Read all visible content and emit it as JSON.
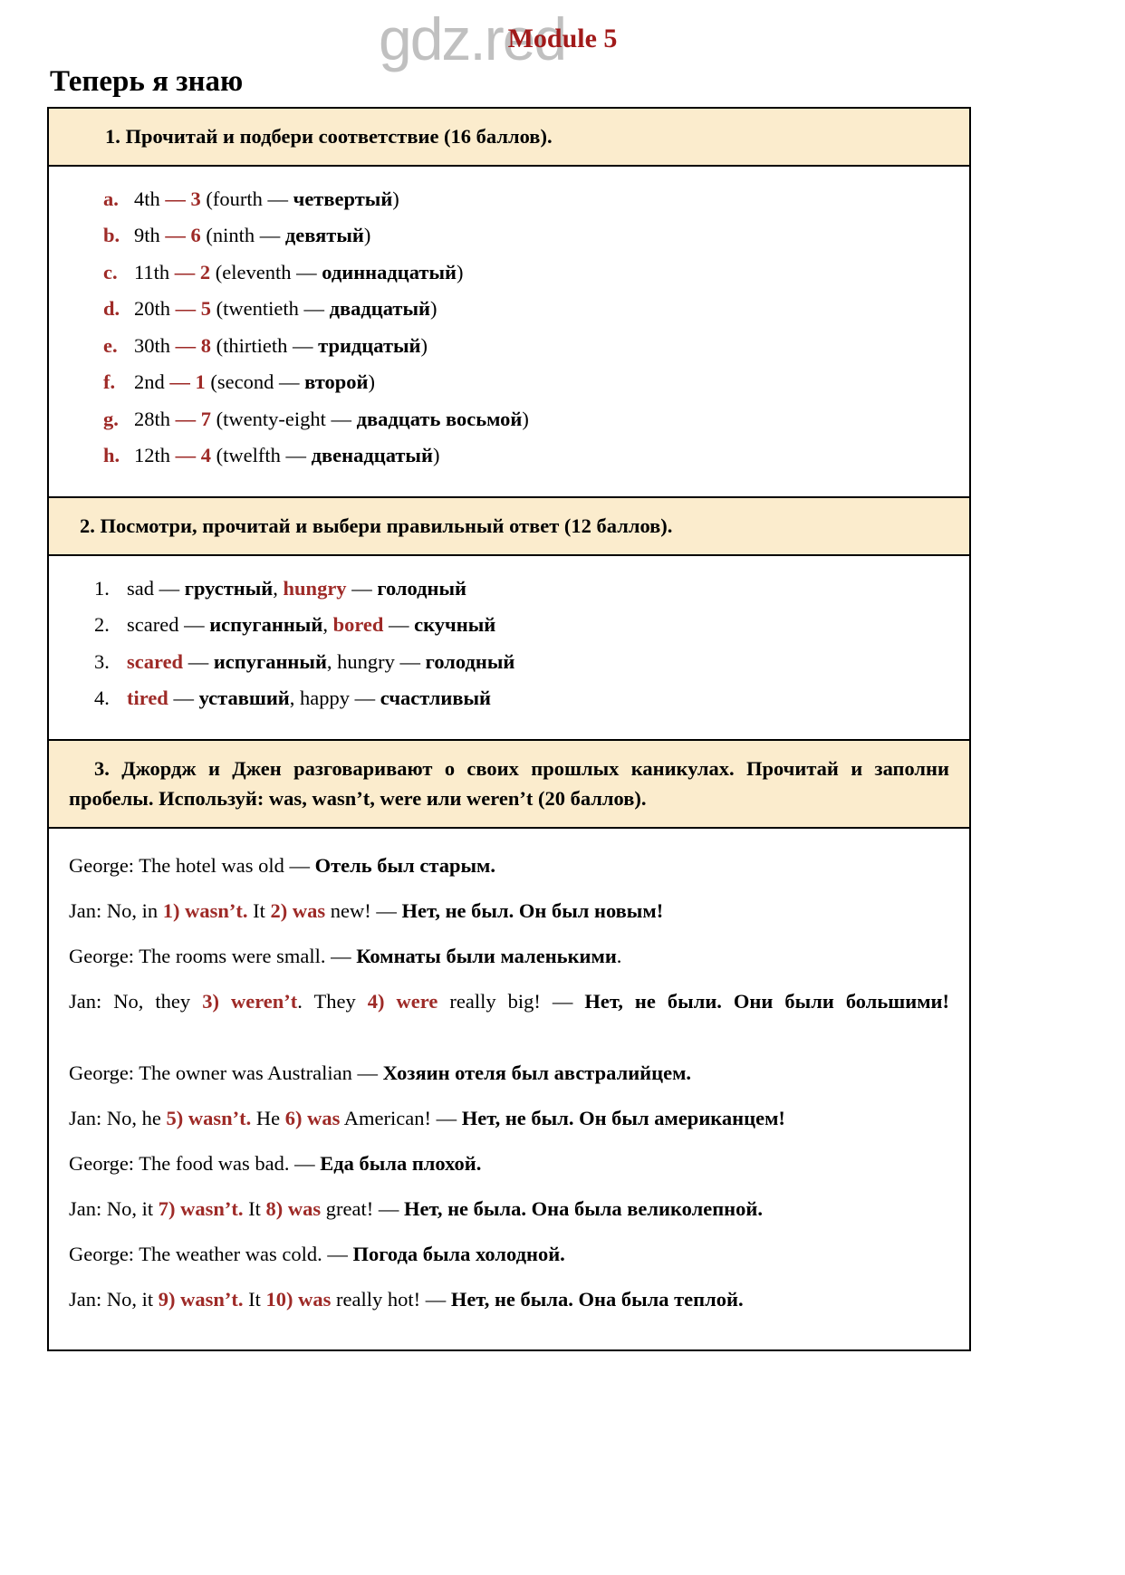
{
  "page": {
    "module_title": "Module 5",
    "section_title": "Теперь я знаю",
    "watermark": "gdz.red",
    "accent_red": "#9e2a27",
    "title_red": "#a11a1a",
    "band_bg": "#fbeccd"
  },
  "task1": {
    "header": "1.  Прочитай и подбери соответствие (16 баллов).",
    "items": [
      {
        "marker": "a.",
        "ordinal": "4th",
        "dash": "—",
        "answer": "3",
        "open": "(fourth",
        "mid": "—",
        "ru": "четвертый",
        "close": ")"
      },
      {
        "marker": "b.",
        "ordinal": "9th",
        "dash": "—",
        "answer": "6",
        "open": "(ninth",
        "mid": "—",
        "ru": "девятый",
        "close": ")"
      },
      {
        "marker": "c.",
        "ordinal": "11th",
        "dash": "—",
        "answer": "2",
        "open": "(eleventh",
        "mid": "—",
        "ru": "одиннадцатый",
        "close": ")"
      },
      {
        "marker": "d.",
        "ordinal": "20th",
        "dash": "—",
        "answer": "5",
        "open": "(twentieth",
        "mid": "—",
        "ru": "двадцатый",
        "close": ")"
      },
      {
        "marker": "e.",
        "ordinal": "30th",
        "dash": "—",
        "answer": "8",
        "open": "(thirtieth",
        "mid": "—",
        "ru": "тридцатый",
        "close": ")"
      },
      {
        "marker": "f.",
        "ordinal": "2nd",
        "dash": "—",
        "answer": "1",
        "open": "(second",
        "mid": "—",
        "ru": "второй",
        "close": ")"
      },
      {
        "marker": "g.",
        "ordinal": "28th",
        "dash": "—",
        "answer": "7",
        "open": "(twenty-eight",
        "mid": "—",
        "ru": "двадцать восьмой",
        "close": ")"
      },
      {
        "marker": "h.",
        "ordinal": "12th",
        "dash": "—",
        "answer": "4",
        "open": "(twelfth",
        "mid": "—",
        "ru": "двенадцатый",
        "close": ")"
      }
    ]
  },
  "task2": {
    "header": "2. Посмотри, прочитай и выбери правильный ответ (12 баллов).",
    "items": [
      {
        "marker": "1.",
        "w1_en": "sad",
        "w1_en_selected": false,
        "w1_dash": "—",
        "w1_ru": "грустный",
        "comma": ",",
        "w2_en": "hungry",
        "w2_en_selected": true,
        "w2_dash": "—",
        "w2_ru": "голодный"
      },
      {
        "marker": "2.",
        "w1_en": "scared",
        "w1_en_selected": false,
        "w1_dash": "—",
        "w1_ru": "испуганный",
        "comma": ",",
        "w2_en": "bored",
        "w2_en_selected": true,
        "w2_dash": "—",
        "w2_ru": "скучный"
      },
      {
        "marker": "3.",
        "w1_en": "scared",
        "w1_en_selected": true,
        "w1_dash": "—",
        "w1_ru": "испуганный",
        "comma": ",",
        "w2_en": "hungry",
        "w2_en_selected": false,
        "w2_dash": "—",
        "w2_ru": "голодный"
      },
      {
        "marker": "4.",
        "w1_en": "tired",
        "w1_en_selected": true,
        "w1_dash": "—",
        "w1_ru": "уставший",
        "comma": ",",
        "w2_en": "happy",
        "w2_en_selected": false,
        "w2_dash": "—",
        "w2_ru": "счастливый"
      }
    ]
  },
  "task3": {
    "header": "3.  Джордж и Джен разговаривают о своих прошлых каникулах. Прочитай и заполни пробелы. Используй: was, wasn’t, were или weren’t (20 баллов).",
    "lines": [
      {
        "speaker": "George:",
        "parts": [
          {
            "t": " The hotel was old — ",
            "s": "en"
          },
          {
            "t": "Отель был старым.",
            "s": "ru"
          }
        ],
        "justify": false
      },
      {
        "speaker": "Jan:",
        "parts": [
          {
            "t": " No, in ",
            "s": "en"
          },
          {
            "t": "1) wasn’t.",
            "s": "ans"
          },
          {
            "t": " It ",
            "s": "en"
          },
          {
            "t": "2) was",
            "s": "ans"
          },
          {
            "t": " new! — ",
            "s": "en"
          },
          {
            "t": "Нет, не был. Он был новым!",
            "s": "ru"
          }
        ],
        "justify": false
      },
      {
        "speaker": "George:",
        "parts": [
          {
            "t": " The rooms were small. — ",
            "s": "en"
          },
          {
            "t": "Комнаты были маленькими",
            "s": "ru"
          },
          {
            "t": ".",
            "s": "en"
          }
        ],
        "justify": false
      },
      {
        "speaker": "Jan:",
        "parts": [
          {
            "t": " No, they ",
            "s": "en"
          },
          {
            "t": "3) weren’t",
            "s": "ans"
          },
          {
            "t": ". They ",
            "s": "en"
          },
          {
            "t": "4) were",
            "s": "ans"
          },
          {
            "t": " really big! — ",
            "s": "en"
          },
          {
            "t": "Нет, не были. Они были большими!",
            "s": "ru"
          }
        ],
        "justify": true
      },
      {
        "speaker": "George:",
        "parts": [
          {
            "t": " The owner was Australian — ",
            "s": "en"
          },
          {
            "t": "Хозяин отеля был австралийцем.",
            "s": "ru"
          }
        ],
        "justify": false
      },
      {
        "speaker": "Jan:",
        "parts": [
          {
            "t": " No, he ",
            "s": "en"
          },
          {
            "t": "5) wasn’t.",
            "s": "ans"
          },
          {
            "t": " He ",
            "s": "en"
          },
          {
            "t": "6) was",
            "s": "ans"
          },
          {
            "t": " American! — ",
            "s": "en"
          },
          {
            "t": "Нет, не был. Он был американцем!",
            "s": "ru"
          }
        ],
        "justify": false
      },
      {
        "speaker": "George:",
        "parts": [
          {
            "t": " The food was bad. — ",
            "s": "en"
          },
          {
            "t": "Еда была плохой.",
            "s": "ru"
          }
        ],
        "justify": false
      },
      {
        "speaker": "Jan:",
        "parts": [
          {
            "t": " No, it ",
            "s": "en"
          },
          {
            "t": "7) wasn’t.",
            "s": "ans"
          },
          {
            "t": " It ",
            "s": "en"
          },
          {
            "t": "8) was",
            "s": "ans"
          },
          {
            "t": " great! — ",
            "s": "en"
          },
          {
            "t": "Нет, не была. Она была великолепной.",
            "s": "ru"
          }
        ],
        "justify": false
      },
      {
        "speaker": "George:",
        "parts": [
          {
            "t": " The weather was cold. — ",
            "s": "en"
          },
          {
            "t": "Погода была холодной.",
            "s": "ru"
          }
        ],
        "justify": false
      },
      {
        "speaker": "Jan:",
        "parts": [
          {
            "t": " No, it ",
            "s": "en"
          },
          {
            "t": "9) wasn’t.",
            "s": "ans"
          },
          {
            "t": " It ",
            "s": "en"
          },
          {
            "t": "10) was",
            "s": "ans"
          },
          {
            "t": " really hot! — ",
            "s": "en"
          },
          {
            "t": "Нет, не была. Она была теплой.",
            "s": "ru"
          }
        ],
        "justify": false
      }
    ]
  }
}
